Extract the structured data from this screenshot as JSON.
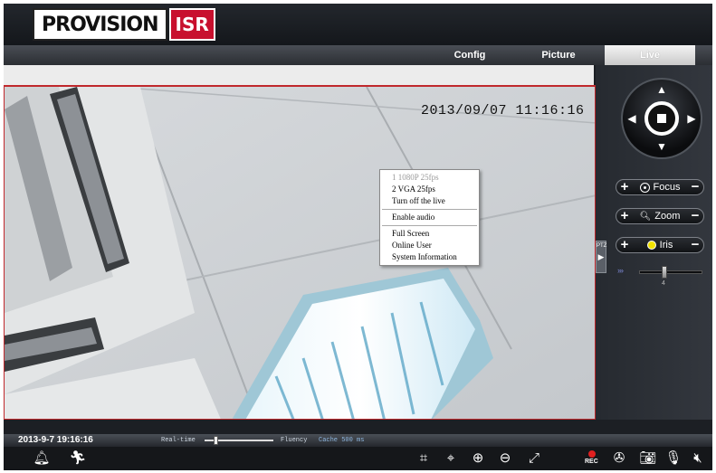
{
  "header": {
    "logo_main": "PROVISION",
    "logo_sub": "ISR"
  },
  "tabs": [
    {
      "label": "Config",
      "active": false
    },
    {
      "label": "Picture",
      "active": false
    },
    {
      "label": "Live",
      "active": true
    }
  ],
  "video": {
    "timestamp": "2013/09/07 11:16:16"
  },
  "context_menu": {
    "items": [
      {
        "label": "1 1080P 25fps",
        "disabled": true
      },
      {
        "label": "2 VGA 25fps",
        "disabled": false
      },
      {
        "label": "Turn off the live",
        "disabled": false
      },
      {
        "label": "Enable audio",
        "disabled": false
      },
      {
        "label": "Full Screen",
        "disabled": false
      },
      {
        "label": "Online User",
        "disabled": false
      },
      {
        "label": "System Information",
        "disabled": false
      }
    ]
  },
  "ptz": {
    "toggle_label": "PTZ",
    "focus_label": "Focus",
    "zoom_label": "Zoom",
    "iris_label": "Iris",
    "plus": "+",
    "minus": "−",
    "speed_value": "4"
  },
  "status": {
    "datetime": "2013-9-7 19:16:16",
    "realtime_label": "Real-time",
    "fluency_label": "Fluency",
    "cache_label": "Cache 500 ms"
  },
  "toolbar": {
    "rec_label": "REC",
    "icons": [
      "alarm-icon",
      "motion-icon",
      "fit-icon",
      "ptz-center-icon",
      "zoom-in-icon",
      "zoom-out-icon",
      "fullscreen-icon",
      "record-icon",
      "film-reel-icon",
      "camera-icon",
      "microphone-icon",
      "speaker-mute-icon"
    ]
  },
  "colors": {
    "accent_red": "#c0282c",
    "iris_yellow": "#f2e200"
  }
}
